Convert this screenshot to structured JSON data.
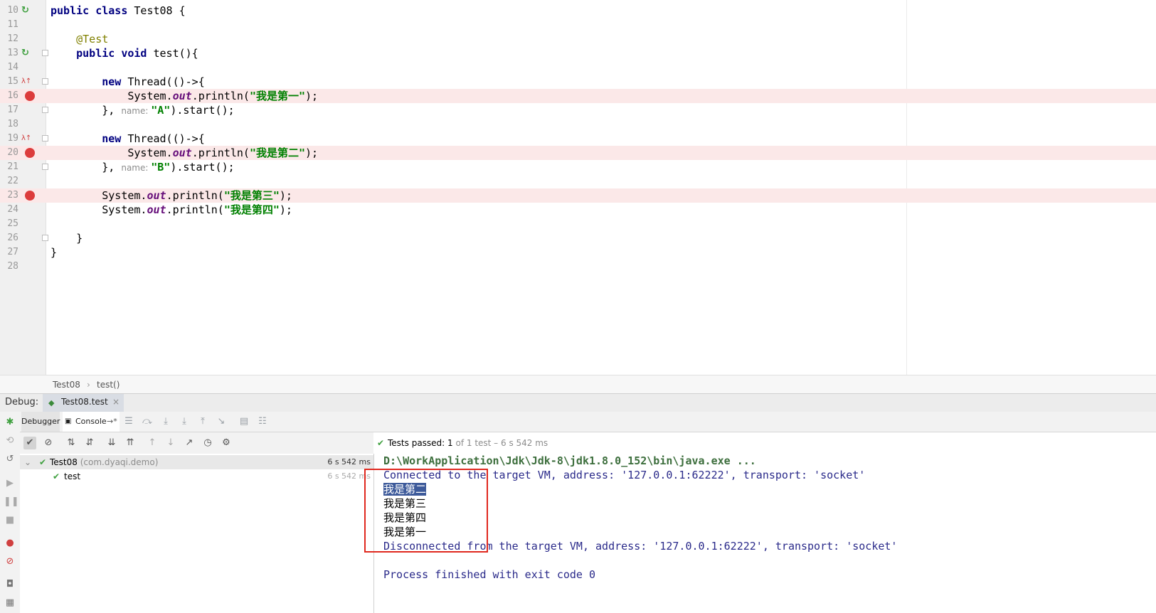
{
  "editor": {
    "lines": [
      {
        "num": "10",
        "parts": [
          [
            "kw",
            "public class "
          ],
          [
            "plain",
            "Test08 {"
          ]
        ],
        "icon": "run-icon"
      },
      {
        "num": "11",
        "parts": []
      },
      {
        "num": "12",
        "parts": [
          [
            "plain",
            "    "
          ],
          [
            "ann",
            "@Test"
          ]
        ]
      },
      {
        "num": "13",
        "parts": [
          [
            "plain",
            "    "
          ],
          [
            "kw",
            "public void "
          ],
          [
            "plain",
            "test(){"
          ]
        ],
        "icon": "run-icon",
        "fold": true
      },
      {
        "num": "14",
        "parts": []
      },
      {
        "num": "15",
        "parts": [
          [
            "plain",
            "        "
          ],
          [
            "kw",
            "new "
          ],
          [
            "plain",
            "Thread(()->{"
          ]
        ],
        "icon": "lambda-icon",
        "fold": true
      },
      {
        "num": "16",
        "parts": [
          [
            "plain",
            "            System."
          ],
          [
            "fld",
            "out"
          ],
          [
            "plain",
            ".println("
          ],
          [
            "str",
            "\"我是第一\""
          ],
          [
            "plain",
            ");"
          ]
        ],
        "breakpoint": true
      },
      {
        "num": "17",
        "parts": [
          [
            "plain",
            "        }, "
          ],
          [
            "hint",
            "name: "
          ],
          [
            "str",
            "\"A\""
          ],
          [
            "plain",
            ").start();"
          ]
        ],
        "fold": true
      },
      {
        "num": "18",
        "parts": []
      },
      {
        "num": "19",
        "parts": [
          [
            "plain",
            "        "
          ],
          [
            "kw",
            "new "
          ],
          [
            "plain",
            "Thread(()->{"
          ]
        ],
        "icon": "lambda-icon",
        "fold": true
      },
      {
        "num": "20",
        "parts": [
          [
            "plain",
            "            System."
          ],
          [
            "fld",
            "out"
          ],
          [
            "plain",
            ".println("
          ],
          [
            "str",
            "\"我是第二\""
          ],
          [
            "plain",
            ");"
          ]
        ],
        "breakpoint": true
      },
      {
        "num": "21",
        "parts": [
          [
            "plain",
            "        }, "
          ],
          [
            "hint",
            "name: "
          ],
          [
            "str",
            "\"B\""
          ],
          [
            "plain",
            ").start();"
          ]
        ],
        "fold": true
      },
      {
        "num": "22",
        "parts": []
      },
      {
        "num": "23",
        "parts": [
          [
            "plain",
            "        System."
          ],
          [
            "fld",
            "out"
          ],
          [
            "plain",
            ".println("
          ],
          [
            "str",
            "\"我是第三\""
          ],
          [
            "plain",
            ");"
          ]
        ],
        "breakpoint": true
      },
      {
        "num": "24",
        "parts": [
          [
            "plain",
            "        System."
          ],
          [
            "fld",
            "out"
          ],
          [
            "plain",
            ".println("
          ],
          [
            "str",
            "\"我是第四\""
          ],
          [
            "plain",
            ");"
          ]
        ]
      },
      {
        "num": "25",
        "parts": []
      },
      {
        "num": "26",
        "parts": [
          [
            "plain",
            "    }"
          ]
        ],
        "fold": true
      },
      {
        "num": "27",
        "parts": [
          [
            "plain",
            "}"
          ]
        ]
      },
      {
        "num": "28",
        "parts": []
      }
    ]
  },
  "breadcrumb": {
    "class": "Test08",
    "sep": "›",
    "method": "test()"
  },
  "debug": {
    "label": "Debug:",
    "tab_title": "Test08.test",
    "tab_close": "×",
    "subtabs": {
      "debugger": "Debugger",
      "console": "Console",
      "console_arrow": "→*"
    }
  },
  "tests": {
    "status_check": "✔",
    "status_prefix": "Tests passed: ",
    "status_count": "1",
    "status_suffix": " of 1 test – 6 s 542 ms",
    "tree": [
      {
        "name": "Test08",
        "pkg": " (com.dyaqi.demo)",
        "duration": "6 s 542 ms",
        "level": 0
      },
      {
        "name": "test",
        "pkg": "",
        "duration": "6 s 542 ms",
        "level": 1
      }
    ]
  },
  "console": {
    "path": "D:\\WorkApplication\\Jdk\\Jdk-8\\jdk1.8.0_152\\bin\\java.exe ...",
    "connected": "Connected to the target VM, address: '127.0.0.1:62222', transport: 'socket'",
    "output": [
      "我是第二",
      "我是第三",
      "我是第四",
      "我是第一"
    ],
    "disconnected": "Disconnected from the target VM, address: '127.0.0.1:62222', transport: 'socket'",
    "finished": "Process finished with exit code 0"
  },
  "colors": {
    "breakpoint": "#dc3c3c",
    "highlight_box": "#e0281e",
    "selection": "#3d5a9a"
  }
}
